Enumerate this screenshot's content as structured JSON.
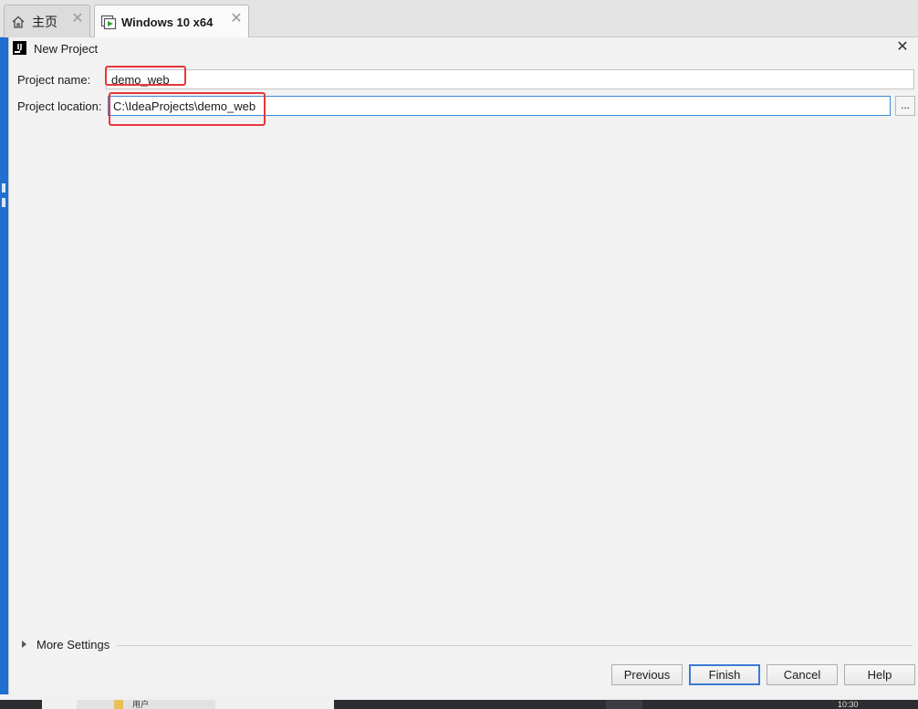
{
  "tabs": [
    {
      "label": "主页",
      "icon": "home-icon"
    },
    {
      "label": "Windows 10 x64",
      "icon": "vm-console-icon"
    }
  ],
  "dialog": {
    "title": "New Project",
    "project_name_label": "Project name:",
    "project_name_value": "demo_web",
    "project_location_label": "Project location:",
    "project_location_value": "C:\\IdeaProjects\\demo_web",
    "browse_label": "...",
    "more_settings_label": "More Settings",
    "buttons": {
      "previous": "Previous",
      "finish": "Finish",
      "cancel": "Cancel",
      "help": "Help"
    }
  },
  "taskbar": {
    "partial_text": "用户",
    "clock_partial": "10:30"
  },
  "colors": {
    "highlight_box": "#e8363a",
    "focus_border": "#3c8ad8",
    "default_button_border": "#3a7bd5",
    "desktop_strip": "#1e6fd0"
  }
}
